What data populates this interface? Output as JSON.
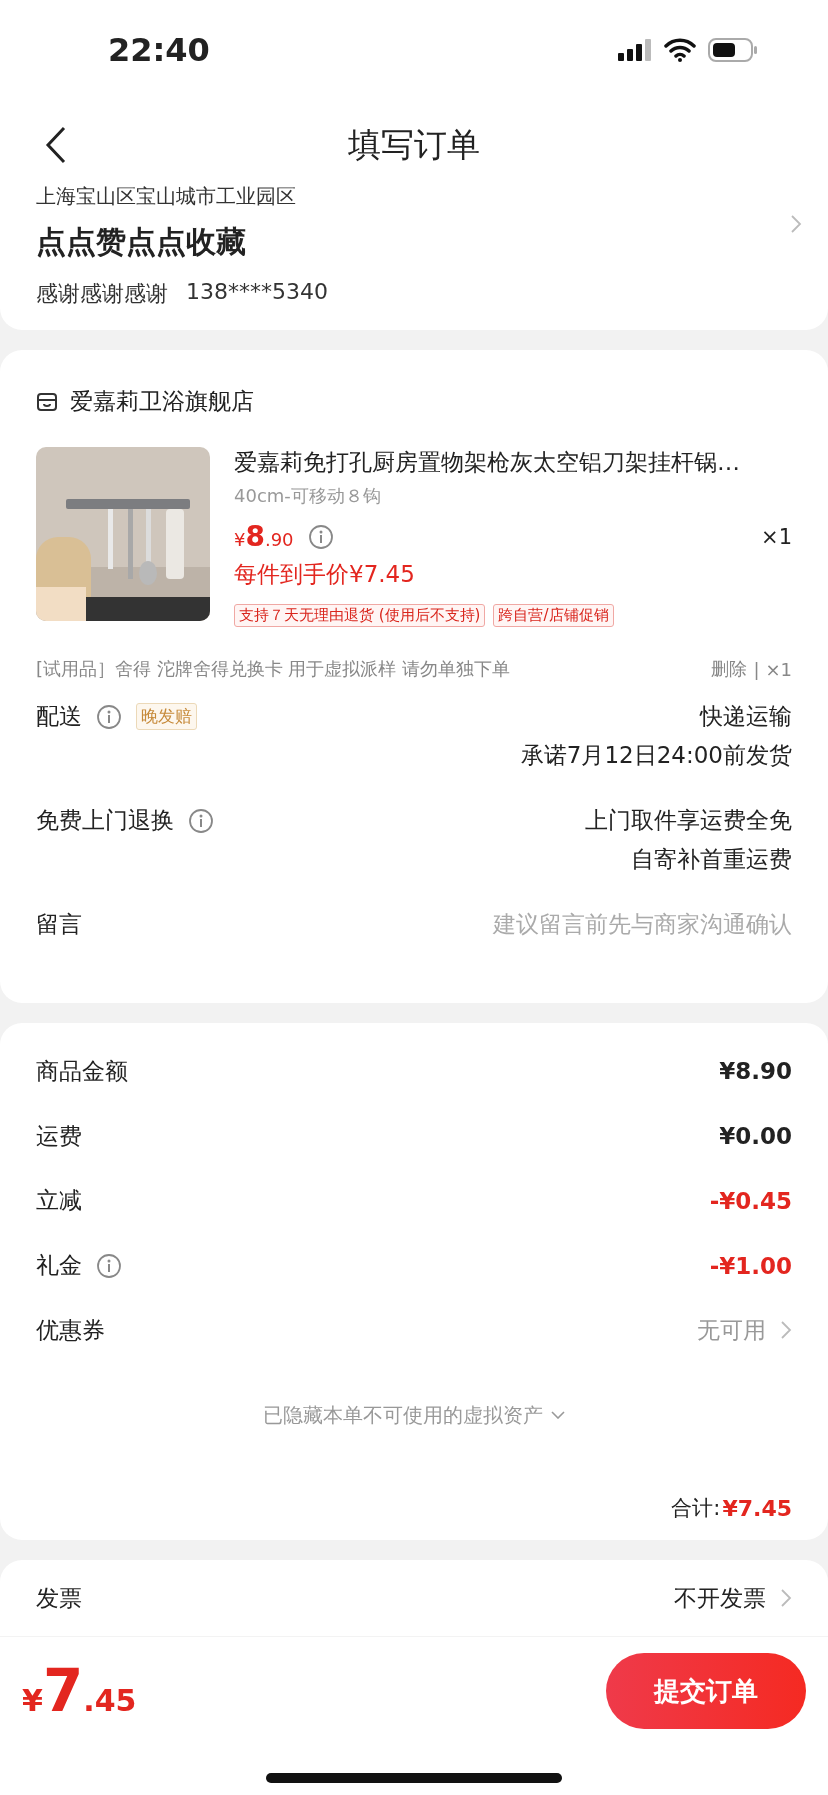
{
  "status_bar": {
    "time": "22:40"
  },
  "header": {
    "title": "填写订单"
  },
  "address": {
    "line": "上海宝山区宝山城市工业园区",
    "name": "点点赞点点收藏",
    "recipient": "感谢感谢感谢",
    "phone": "138****5340"
  },
  "store": {
    "name": "爱嘉莉卫浴旗舰店"
  },
  "product": {
    "title": "爱嘉莉免打孔厨房置物架枪灰太空铝刀架挂杆锅…",
    "spec": "40cm-可移动８钩",
    "price": {
      "currency": "¥",
      "whole": "8",
      "fraction": ".90"
    },
    "quantity": "×1",
    "promo_price": "每件到手价¥7.45",
    "tags": [
      "支持７天无理由退货 (使用后不支持)",
      "跨自营/店铺促销"
    ]
  },
  "gift": {
    "text": "[试用品］舍得 沱牌舍得兑换卡 用于虚拟派样 请勿单独下单",
    "delete": "删除",
    "separator": "|",
    "quantity": "×1"
  },
  "services": [
    {
      "label": "配送",
      "info": true,
      "badge": "晚发赔",
      "kind": "value",
      "values": [
        "快递运输",
        "承诺7月12日24:00前发货"
      ]
    },
    {
      "label": "免费上门退换",
      "info": true,
      "kind": "value",
      "values": [
        "上门取件享运费全免",
        "自寄补首重运费"
      ]
    },
    {
      "label": "留言",
      "info": false,
      "kind": "placeholder",
      "values": [
        "建议留言前先与商家沟通确认"
      ]
    }
  ],
  "fees": [
    {
      "label": "商品金额",
      "info": false,
      "kind": "amount",
      "value": "¥8.90"
    },
    {
      "label": "运费",
      "info": false,
      "kind": "amount",
      "value": "¥0.00"
    },
    {
      "label": "立减",
      "info": false,
      "kind": "discount",
      "value": "-¥0.45"
    },
    {
      "label": "礼金",
      "info": true,
      "kind": "discount",
      "value": "-¥1.00"
    },
    {
      "label": "优惠券",
      "info": false,
      "kind": "link",
      "value": "无可用"
    }
  ],
  "hidden_assets": "已隐藏本单不可使用的虚拟资产",
  "total": {
    "label": "合计:",
    "value": "¥7.45"
  },
  "invoice": {
    "label": "发票",
    "value": "不开发票"
  },
  "footer": {
    "price": {
      "currency": "¥",
      "whole": "7",
      "fraction": ".45"
    },
    "submit": "提交订单"
  }
}
